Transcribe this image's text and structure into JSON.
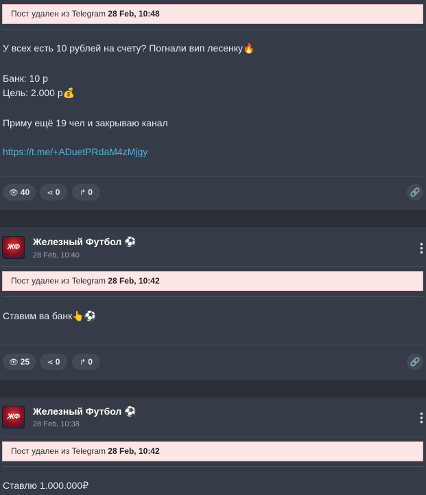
{
  "banner": {
    "prefix": "Пост удален из Telegram"
  },
  "posts": [
    {
      "banner_time": "28 Feb, 10:48",
      "lines": [
        "У всех есть 10 рублей на счету? Погнали вип лесенку🔥",
        "Банк: 10 р",
        "Цель: 2.000 р💰",
        "Приму ещё 19 чел и закрываю канал"
      ],
      "link": "https://t.me/+ADuetPRdaM4zMjgy",
      "views": "40",
      "shares": "0",
      "forwards": "0"
    },
    {
      "channel": "Железный Футбол ⚽",
      "date": "28 Feb, 10:40",
      "avatar_text": "ЖФ",
      "banner_time": "28 Feb, 10:42",
      "lines": [
        "Ставим ва банк👆⚽"
      ],
      "views": "25",
      "shares": "0",
      "forwards": "0"
    },
    {
      "channel": "Железный Футбол ⚽",
      "date": "28 Feb, 10:38",
      "avatar_text": "ЖФ",
      "banner_time": "28 Feb, 10:42",
      "lines": [
        "Ставлю 1.000.000₽"
      ]
    }
  ],
  "icons": {
    "views": "eye-icon",
    "shares": "share-icon",
    "forwards": "forward-icon",
    "link": "link-icon",
    "menu": "more-vertical-icon"
  },
  "colors": {
    "banner_bg": "#fde6e6",
    "link": "#4cb4e6",
    "card": "#363c47",
    "page": "#2a2f38"
  }
}
